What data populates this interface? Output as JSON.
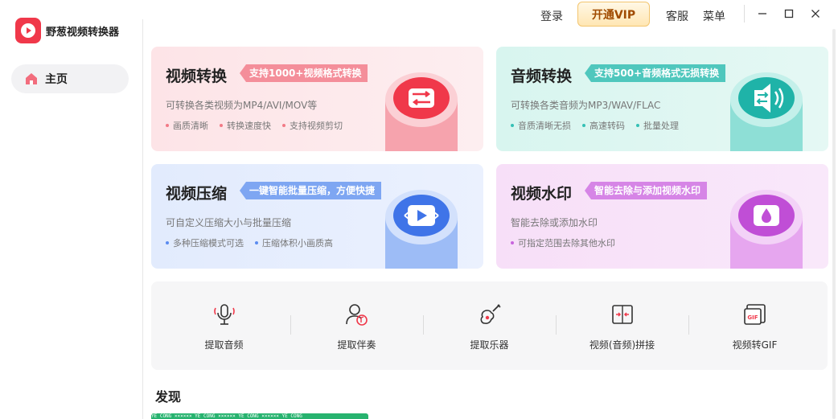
{
  "app": {
    "name": "野葱视频转换器"
  },
  "sidebar": {
    "items": [
      {
        "label": "主页",
        "icon": "home-icon"
      }
    ]
  },
  "topbar": {
    "login": "登录",
    "vip": "开通VIP",
    "service": "客服",
    "menu": "菜单"
  },
  "colors": {
    "brand": "#f0384a",
    "video_convert": "#f27a86",
    "audio_convert": "#35c0b5",
    "video_compress": "#5b8cf0",
    "video_watermark": "#c864dd"
  },
  "cards": [
    {
      "title": "视频转换",
      "tag": "支持1000+视频格式转换",
      "desc": "可转换各类视频为MP4/AVI/MOV等",
      "bullets": [
        "画质清晰",
        "转换速度快",
        "支持视频剪切"
      ]
    },
    {
      "title": "音频转换",
      "tag": "支持500+音频格式无损转换",
      "desc": "可转换各类音频为MP3/WAV/FLAC",
      "bullets": [
        "音质清晰无损",
        "高速转码",
        "批量处理"
      ]
    },
    {
      "title": "视频压缩",
      "tag": "一键智能批量压缩，方便快捷",
      "desc": "可自定义压缩大小与批量压缩",
      "bullets": [
        "多种压缩模式可选",
        "压缩体积小画质高"
      ]
    },
    {
      "title": "视频水印",
      "tag": "智能去除与添加视频水印",
      "desc": "智能去除或添加水印",
      "bullets": [
        "可指定范围去除其他水印"
      ]
    }
  ],
  "tools": [
    {
      "label": "提取音频",
      "icon": "microphone-icon"
    },
    {
      "label": "提取伴奏",
      "icon": "accompaniment-icon"
    },
    {
      "label": "提取乐器",
      "icon": "guitar-icon"
    },
    {
      "label": "视频(音频)拼接",
      "icon": "merge-icon"
    },
    {
      "label": "视频转GIF",
      "icon": "gif-icon"
    }
  ],
  "discover": {
    "title": "发现",
    "banner_text": "YE CONG ×××××× YE CONG ×××××× YE CONG ×××××× YE CONG"
  }
}
